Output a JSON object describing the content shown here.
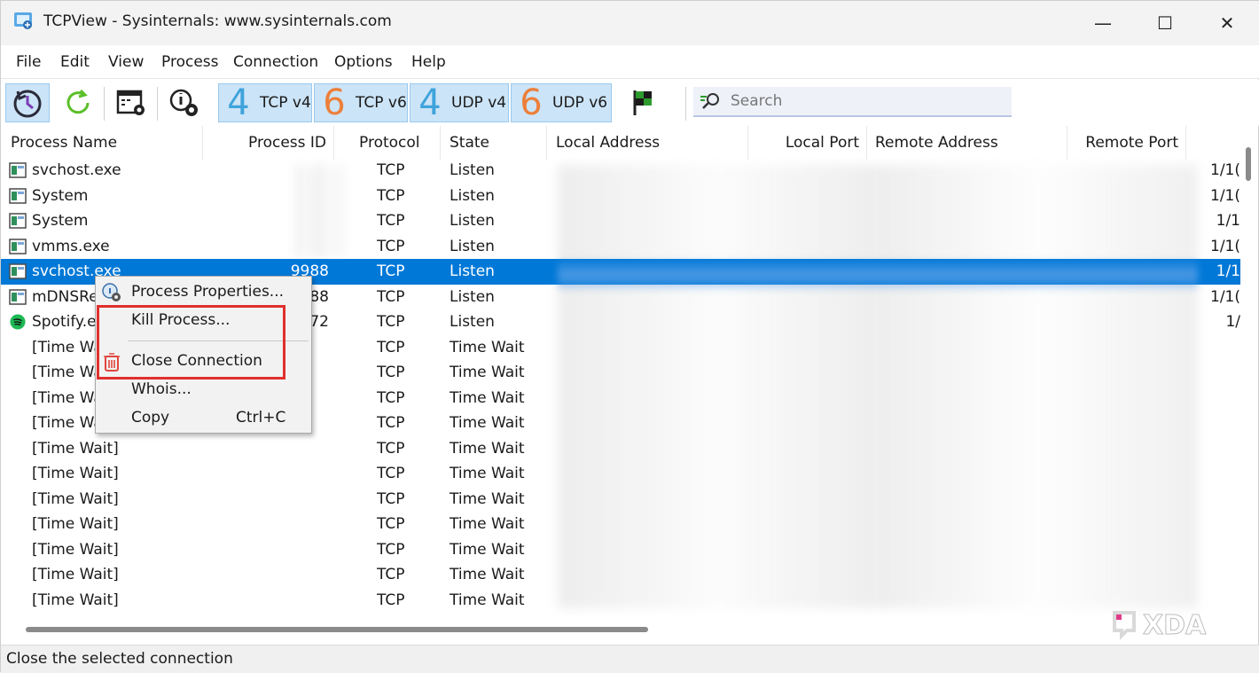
{
  "window": {
    "title": "TCPView - Sysinternals: www.sysinternals.com",
    "min_glyph": "—",
    "max_glyph": "☐",
    "close_glyph": "✕"
  },
  "menu": [
    "File",
    "Edit",
    "View",
    "Process",
    "Connection",
    "Options",
    "Help"
  ],
  "toolbar": {
    "filters": [
      {
        "digit": "4",
        "label": "TCP v4",
        "color": "#3fa3db"
      },
      {
        "digit": "6",
        "label": "TCP v6",
        "color": "#ec7f3a"
      },
      {
        "digit": "4",
        "label": "UDP v4",
        "color": "#3fa3db"
      },
      {
        "digit": "6",
        "label": "UDP v6",
        "color": "#ec7f3a"
      }
    ],
    "search_placeholder": "Search"
  },
  "columns": [
    "Process Name",
    "Process ID",
    "Protocol",
    "State",
    "Local Address",
    "Local Port",
    "Remote Address",
    "Remote Port"
  ],
  "rows": [
    {
      "name": "svchost.exe",
      "pid": "",
      "protocol": "TCP",
      "state": "Listen",
      "remote_port": "1/1(",
      "icon": "process-icon"
    },
    {
      "name": "System",
      "pid": "",
      "protocol": "TCP",
      "state": "Listen",
      "remote_port": "1/1(",
      "icon": "process-icon"
    },
    {
      "name": "System",
      "pid": "",
      "protocol": "TCP",
      "state": "Listen",
      "remote_port": "1/1",
      "icon": "process-icon"
    },
    {
      "name": "vmms.exe",
      "pid": "",
      "protocol": "TCP",
      "state": "Listen",
      "remote_port": "1/1(",
      "icon": "process-icon"
    },
    {
      "name": "svchost.exe",
      "pid": "9988",
      "protocol": "TCP",
      "state": "Listen",
      "remote_port": "1/1",
      "icon": "process-icon",
      "selected": true
    },
    {
      "name": "mDNSRe",
      "pid": "88",
      "protocol": "TCP",
      "state": "Listen",
      "remote_port": "1/1(",
      "icon": "process-icon"
    },
    {
      "name": "Spotify.ex",
      "pid": "72",
      "protocol": "TCP",
      "state": "Listen",
      "remote_port": "1/",
      "icon": "spotify-icon"
    },
    {
      "name": "[Time Wai",
      "pid": "",
      "protocol": "TCP",
      "state": "Time Wait",
      "remote_port": "",
      "icon": ""
    },
    {
      "name": "[Time Wa",
      "pid": "",
      "protocol": "TCP",
      "state": "Time Wait",
      "remote_port": "",
      "icon": ""
    },
    {
      "name": "[Time Wa",
      "pid": "",
      "protocol": "TCP",
      "state": "Time Wait",
      "remote_port": "",
      "icon": ""
    },
    {
      "name": "[Time Wa",
      "pid": "",
      "protocol": "TCP",
      "state": "Time Wait",
      "remote_port": "",
      "icon": ""
    },
    {
      "name": "[Time Wait]",
      "pid": "",
      "protocol": "TCP",
      "state": "Time Wait",
      "remote_port": "",
      "icon": ""
    },
    {
      "name": "[Time Wait]",
      "pid": "",
      "protocol": "TCP",
      "state": "Time Wait",
      "remote_port": "",
      "icon": ""
    },
    {
      "name": "[Time Wait]",
      "pid": "",
      "protocol": "TCP",
      "state": "Time Wait",
      "remote_port": "",
      "icon": ""
    },
    {
      "name": "[Time Wait]",
      "pid": "",
      "protocol": "TCP",
      "state": "Time Wait",
      "remote_port": "",
      "icon": ""
    },
    {
      "name": "[Time Wait]",
      "pid": "",
      "protocol": "TCP",
      "state": "Time Wait",
      "remote_port": "",
      "icon": ""
    },
    {
      "name": "[Time Wait]",
      "pid": "",
      "protocol": "TCP",
      "state": "Time Wait",
      "remote_port": "",
      "icon": ""
    },
    {
      "name": "[Time Wait]",
      "pid": "",
      "protocol": "TCP",
      "state": "Time Wait",
      "remote_port": "",
      "icon": ""
    }
  ],
  "context_menu": {
    "items": [
      {
        "label": "Process Properties...",
        "shortcut": "",
        "icon": "process-properties-icon"
      },
      {
        "label": "Kill Process...",
        "shortcut": "",
        "icon": ""
      },
      {
        "label": "Close Connection",
        "shortcut": "",
        "icon": "trash-icon"
      },
      {
        "label": "Whois...",
        "shortcut": "",
        "icon": ""
      },
      {
        "label": "Copy",
        "shortcut": "Ctrl+C",
        "icon": ""
      }
    ],
    "highlight_color": "#e0302d"
  },
  "status": "Close the selected connection",
  "watermark": "XDA",
  "colors": {
    "selection": "#0078d7",
    "filter_active": "#cce4f7"
  }
}
